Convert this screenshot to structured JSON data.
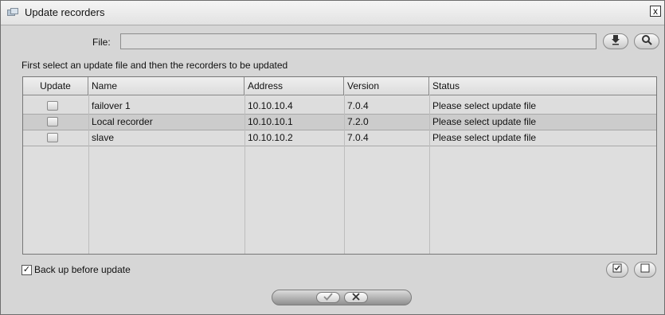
{
  "window": {
    "title": "Update recorders",
    "close_label": "x"
  },
  "file": {
    "label": "File:",
    "value": "",
    "placeholder": ""
  },
  "hint": "First select an update file and then the recorders to be updated",
  "table": {
    "columns": [
      "Update",
      "Name",
      "Address",
      "Version",
      "Status"
    ],
    "rows": [
      {
        "checked": false,
        "name": "failover 1",
        "address": "10.10.10.4",
        "version": "7.0.4",
        "status": "Please select update file"
      },
      {
        "checked": false,
        "name": "Local recorder",
        "address": "10.10.10.1",
        "version": "7.2.0",
        "status": "Please select update file"
      },
      {
        "checked": false,
        "name": "slave",
        "address": "10.10.10.2",
        "version": "7.0.4",
        "status": "Please select update file"
      }
    ]
  },
  "backup": {
    "label": "Back up before update",
    "checked": true,
    "check_glyph": "✓"
  },
  "icons": {
    "title": "update-recorders-icon",
    "upload": "upload-icon",
    "search": "magnifier-icon",
    "select_all": "select-all-icon",
    "deselect_all": "deselect-all-icon",
    "ok": "check-icon",
    "cancel": "x-icon"
  }
}
